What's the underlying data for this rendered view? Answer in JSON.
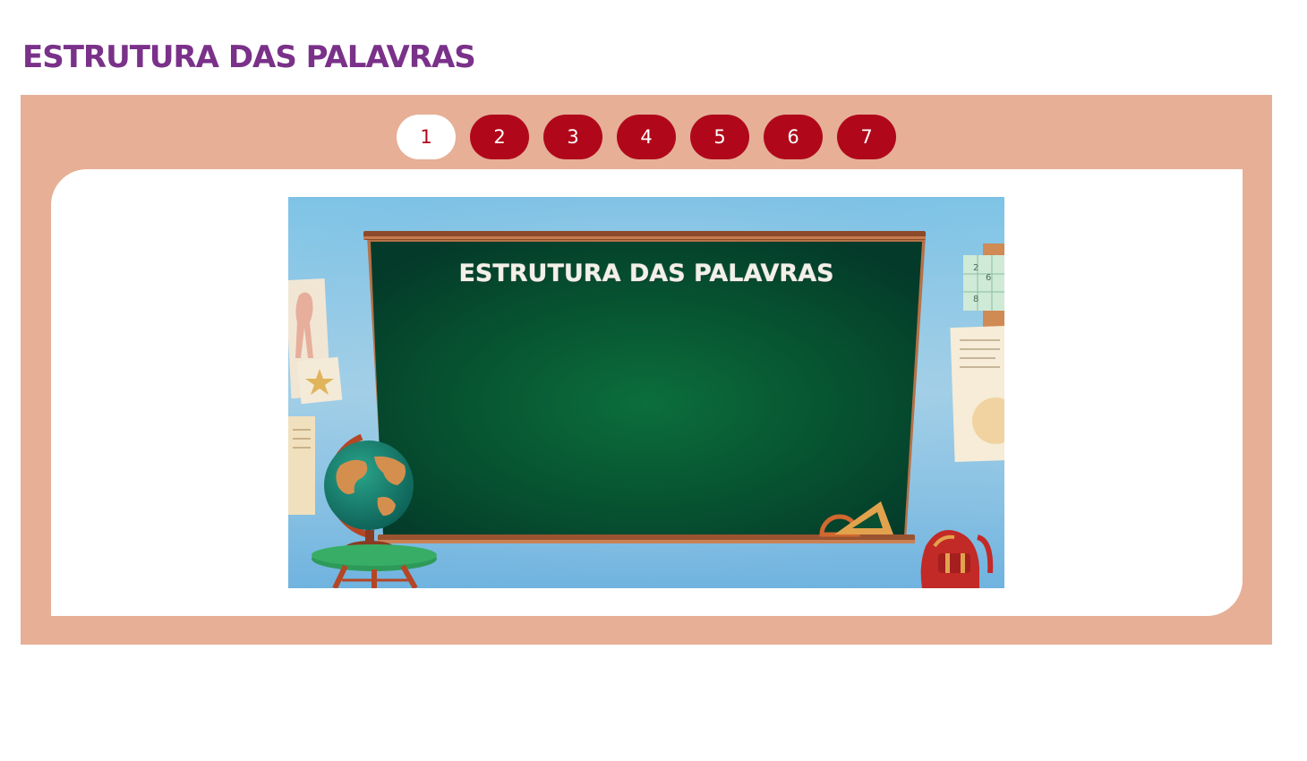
{
  "page": {
    "title": "ESTRUTURA DAS PALAVRAS"
  },
  "pagination": {
    "active": "1",
    "pages": [
      "1",
      "2",
      "3",
      "4",
      "5",
      "6",
      "7"
    ]
  },
  "slide": {
    "heading": "ESTRUTURA DAS PALAVRAS",
    "sudoku_digits": [
      "2",
      "6",
      "8"
    ]
  },
  "colors": {
    "title": "#7a3189",
    "frame": "#e6af96",
    "button": "#b0081a",
    "active_button": "#ffffff",
    "chalkboard": "#0b5a38"
  }
}
